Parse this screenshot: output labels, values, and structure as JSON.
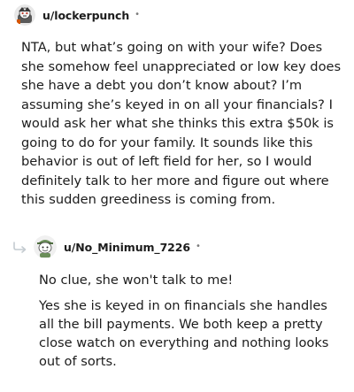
{
  "comment": {
    "username": "u/lockerpunch",
    "separator": "•",
    "avatar_icon": "snoo-avatar-icon",
    "body": "NTA, but what’s going on with your wife? Does she somehow feel unappreciated or low key does she have a debt you don’t know about? I’m assuming she’s keyed in on all your financials? I would ask her what she thinks this extra $50k is going to do for your family. It sounds like this behavior is out of left field for her, so I would definitely talk to her more and figure out where this sudden greediness is coming from."
  },
  "reply": {
    "arrow_icon": "reply-arrow-icon",
    "avatar_icon": "snoo-avatar-icon",
    "username": "u/No_Minimum_7226",
    "separator": "•",
    "paragraphs": [
      "No clue, she won't talk to me!",
      "Yes she is keyed in on financials she handles all the bill payments. We both keep a pretty close watch on everything and nothing looks out of sorts."
    ]
  }
}
